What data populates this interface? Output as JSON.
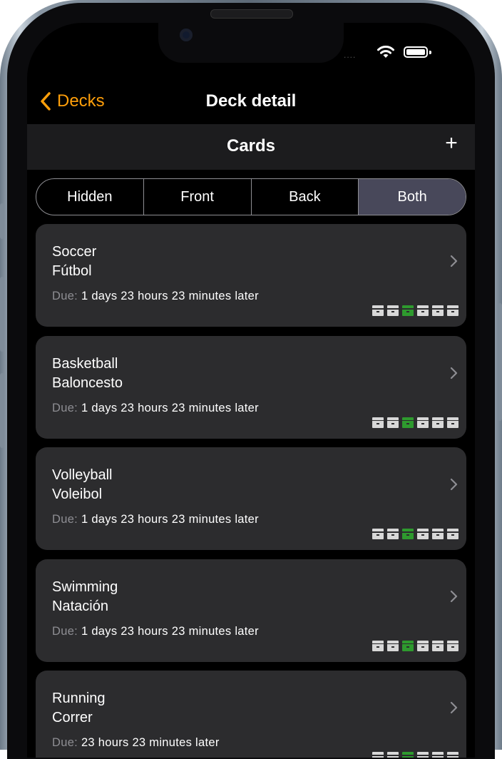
{
  "status_bar": {
    "signal_dots": "....",
    "wifi_icon": "wifi-icon",
    "battery_icon": "battery-icon"
  },
  "nav": {
    "back_label": "Decks",
    "title": "Deck detail"
  },
  "section": {
    "title": "Cards",
    "add_label": "+"
  },
  "segments": [
    {
      "label": "Hidden",
      "selected": false
    },
    {
      "label": "Front",
      "selected": false
    },
    {
      "label": "Back",
      "selected": false
    },
    {
      "label": "Both",
      "selected": true
    }
  ],
  "due_label": "Due:",
  "cards": [
    {
      "front": "Soccer",
      "back": "Fútbol",
      "due": "1 days 23 hours 23 minutes later",
      "active_box": 3,
      "box_count": 6
    },
    {
      "front": "Basketball",
      "back": "Baloncesto",
      "due": "1 days 23 hours 23 minutes later",
      "active_box": 3,
      "box_count": 6
    },
    {
      "front": "Volleyball",
      "back": "Voleibol",
      "due": "1 days 23 hours 23 minutes later",
      "active_box": 3,
      "box_count": 6
    },
    {
      "front": "Swimming",
      "back": "Natación",
      "due": "1 days 23 hours 23 minutes later",
      "active_box": 3,
      "box_count": 6
    },
    {
      "front": "Running",
      "back": "Correr",
      "due": "23 hours 23 minutes later",
      "active_box": 3,
      "box_count": 6
    }
  ],
  "colors": {
    "accent": "#ff9f0a",
    "active_box": "#2e9a2e",
    "card_bg": "#2c2c2e",
    "header_bg": "#1c1c1e"
  }
}
